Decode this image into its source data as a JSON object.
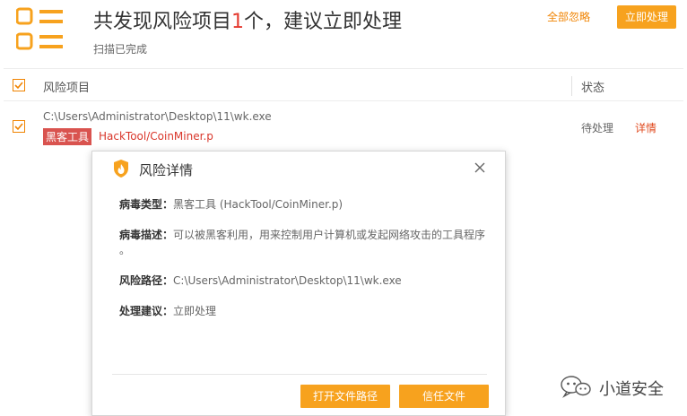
{
  "header": {
    "title_prefix": "共发现风险项目",
    "title_count": "1",
    "title_suffix": "个，建议立即处理",
    "subtitle": "扫描已完成",
    "ignore_all_label": "全部忽略",
    "handle_all_label": "立即处理"
  },
  "table": {
    "col_risk": "风险项目",
    "col_status": "状态",
    "rows": [
      {
        "path": "C:\\Users\\Administrator\\Desktop\\11\\wk.exe",
        "tag": "黑客工具",
        "virus": "HackTool/CoinMiner.p",
        "status": "待处理",
        "detail": "详情"
      }
    ]
  },
  "dialog": {
    "title": "风险详情",
    "type_label": "病毒类型：",
    "type_value": "黑客工具 (HackTool/CoinMiner.p)",
    "desc_label": "病毒描述：",
    "desc_value": "可以被黑客利用，用来控制用户计算机或发起网络攻击的工具程序",
    "desc_tail": "。",
    "path_label": "风险路径：",
    "path_value": "C:\\Users\\Administrator\\Desktop\\11\\wk.exe",
    "advice_label": "处理建议：",
    "advice_value": "立即处理",
    "open_path_label": "打开文件路径",
    "trust_label": "信任文件"
  },
  "watermark": {
    "text": "小道安全"
  },
  "colors": {
    "accent": "#f7a21e",
    "accent_text": "#f08300",
    "danger": "#d9534f",
    "danger_text": "#d9362a"
  },
  "icons": {
    "header": "list-icon",
    "dialog": "shield-flame-icon",
    "close": "close-icon",
    "watermark": "wechat-icon"
  }
}
